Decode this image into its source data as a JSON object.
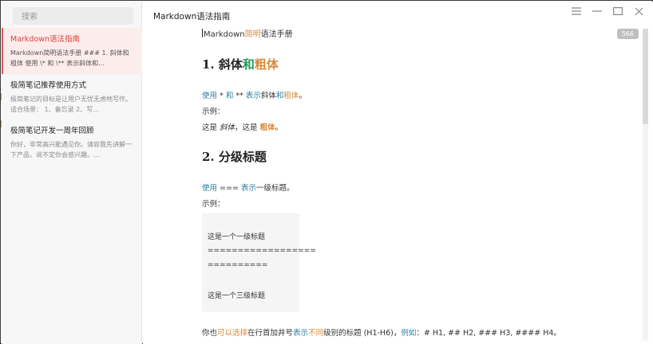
{
  "sidebar": {
    "search_placeholder": "搜索",
    "notes": [
      {
        "title": "Markdown语法指南",
        "snippet": "Markdown简明语法手册 ### 1. 斜体和粗体 使用 \\* 和 \\** 表示斜体和...",
        "active": true
      },
      {
        "title": "极简笔记推荐使用方式",
        "snippet": "极简笔记的目标是让用户无忧无虑地写作。 适合场景： 1、备忘录 2、写...",
        "active": false
      },
      {
        "title": "极简笔记开发一周年回顾",
        "snippet": "你好，非常高兴能遇见你。请容我先讲解一下产品，说不定你会感兴趣。...",
        "active": false
      }
    ]
  },
  "main": {
    "window_title": "Markdown语法指南",
    "word_count": "566",
    "controls": {
      "menu": "menu-icon",
      "minimize": "minimize-icon",
      "maximize": "maximize-icon",
      "close": "close-icon"
    },
    "doc": {
      "title_a": "Markdown",
      "title_b": "简明",
      "title_c": "语法手册",
      "h1_num": "1. 斜体",
      "h1_and": "和",
      "h1_bold": "粗体",
      "p1_use": "使用",
      "p1_star": " * ",
      "p1_he": "和",
      "p1_stars": " ** ",
      "p1_show": "表示",
      "p1_italic": "斜体",
      "p1_he2": "和",
      "p1_bold": "粗体",
      "p1_end": "。",
      "example1": "示例：",
      "ex1_a": "这是 ",
      "ex1_italic": "斜体",
      "ex1_b": "，这是 ",
      "ex1_bold": "粗体",
      "ex1_end": "。",
      "h2": "2. 分级标题",
      "p2_use": "使用",
      "p2_eq": " === ",
      "p2_show": "表示",
      "p2_rest": "一级标题。",
      "example2": "示例：",
      "code_l1": "这是一个一级标题",
      "code_l2": "==================",
      "code_l3": "==========",
      "code_l4": "这是一个三级标题",
      "p3_a": "你也",
      "p3_b": "可以选择",
      "p3_c": "在行首加井号",
      "p3_d": "表示",
      "p3_e": "不同",
      "p3_f": "级别的标题 (H1-H6)，",
      "p3_g": "例如",
      "p3_h": "：# H1, ## H2, ### H3, #### H4。"
    }
  },
  "colors": {
    "accent": "#d9443a",
    "orange": "#d9893a",
    "teal": "#2a7fa0",
    "green": "#1f9a5a"
  }
}
